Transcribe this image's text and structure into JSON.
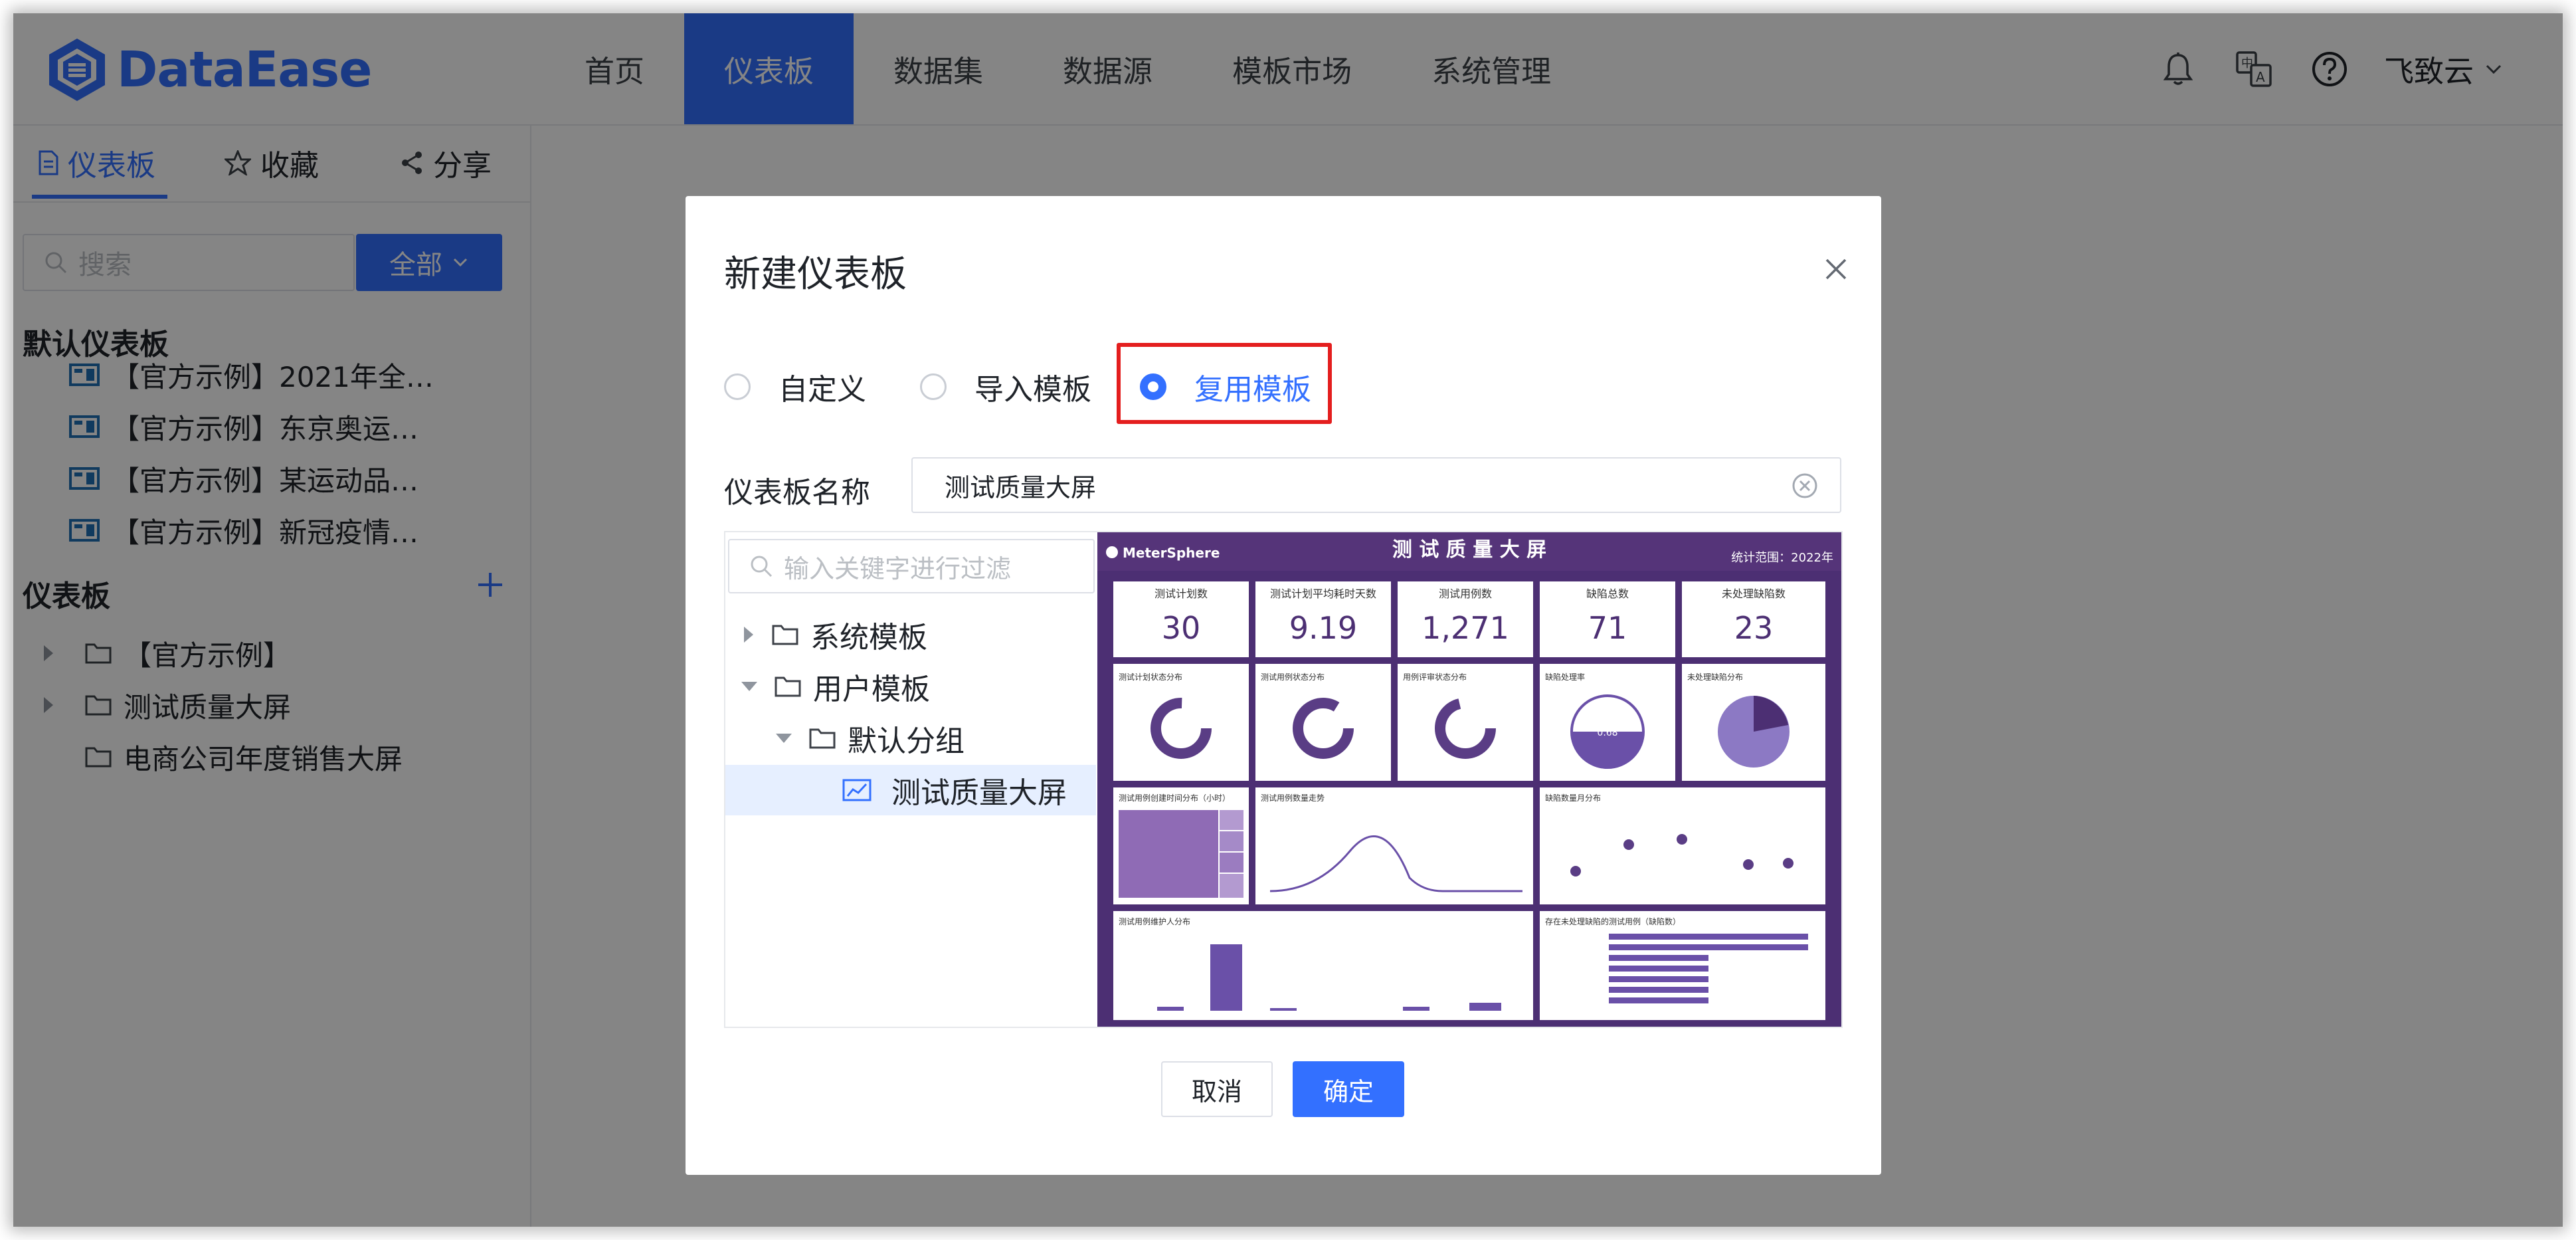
{
  "app": {
    "logo_text": "DataEase",
    "brand_color": "#3370ff"
  },
  "nav": {
    "items": [
      "首页",
      "仪表板",
      "数据集",
      "数据源",
      "模板市场",
      "系统管理"
    ],
    "active": "仪表板"
  },
  "header": {
    "user": "飞致云",
    "icons": [
      "bell-icon",
      "translate-icon",
      "help-icon"
    ]
  },
  "sidebar": {
    "tabs": [
      {
        "label": "仪表板",
        "icon": "document-icon"
      },
      {
        "label": "收藏",
        "icon": "star-icon"
      },
      {
        "label": "分享",
        "icon": "share-icon"
      }
    ],
    "search_placeholder": "搜索",
    "filter_label": "全部",
    "default_section_title": "默认仪表板",
    "default_items": [
      "【官方示例】2021年全…",
      "【官方示例】东京奥运…",
      "【官方示例】某运动品…",
      "【官方示例】新冠疫情…"
    ],
    "panel_section_title": "仪表板",
    "tree": [
      {
        "label": "【官方示例】",
        "expandable": true
      },
      {
        "label": "测试质量大屏",
        "expandable": true
      },
      {
        "label": "电商公司年度销售大屏",
        "expandable": false
      }
    ]
  },
  "dialog": {
    "title": "新建仪表板",
    "options": [
      "自定义",
      "导入模板",
      "复用模板"
    ],
    "selected_option": "复用模板",
    "name_label": "仪表板名称",
    "name_value": "测试质量大屏",
    "filter_placeholder": "输入关键字进行过滤",
    "template_tree": [
      {
        "label": "系统模板",
        "level": 0,
        "state": "collapsed"
      },
      {
        "label": "用户模板",
        "level": 0,
        "state": "expanded"
      },
      {
        "label": "默认分组",
        "level": 1,
        "state": "expanded"
      },
      {
        "label": "测试质量大屏",
        "level": 2,
        "state": "selected"
      }
    ],
    "cancel_label": "取消",
    "confirm_label": "确定",
    "highlight_color": "#e41e1e"
  },
  "preview": {
    "brand": "MeterSphere",
    "title": "测 试 质 量 大 屏",
    "range": "统计范围：2022年",
    "kpis": [
      {
        "label": "测试计划数",
        "value": "30"
      },
      {
        "label": "测试计划平均耗时天数",
        "value": "9.19"
      },
      {
        "label": "测试用例数",
        "value": "1,271"
      },
      {
        "label": "缺陷总数",
        "value": "71"
      },
      {
        "label": "未处理缺陷数",
        "value": "23"
      }
    ],
    "panels": [
      "测试计划状态分布",
      "测试用例状态分布",
      "用例评审状态分布",
      "缺陷处理率",
      "未处理缺陷分布",
      "测试用例创建时间分布（小时）",
      "测试用例数量走势",
      "缺陷数量月分布",
      "测试用例维护人分布",
      "存在未处理缺陷的测试用例（缺陷数）"
    ],
    "gauge_value": "0.68"
  }
}
